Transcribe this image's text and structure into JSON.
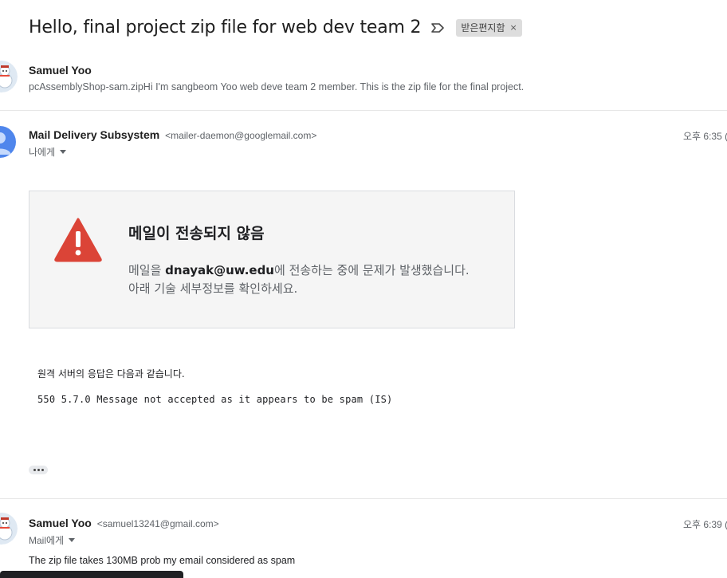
{
  "thread": {
    "subject": "Hello, final project zip file for web dev team 2",
    "label": "받은편지함",
    "label_remove": "×"
  },
  "messages": [
    {
      "sender_name": "Samuel Yoo",
      "snippet": "pcAssemblyShop-sam.zipHi I'm sangbeom Yoo web deve team 2 member. This is the zip file for the final project.",
      "avatar": "snowman-avatar"
    },
    {
      "sender_name": "Mail Delivery Subsystem",
      "sender_email": "<mailer-daemon@googlemail.com>",
      "to": "나에게",
      "time": "오후 6:35 (",
      "avatar": "person-avatar",
      "bounce": {
        "title": "메일이 전송되지 않음",
        "line1_prefix": "메일을 ",
        "line1_email": "dnayak@uw.edu",
        "line1_suffix": "에 전송하는 중에 문제가 발생했습니다.",
        "line2": "아래 기술 세부정보를 확인하세요."
      },
      "remote_intro": "원격 서버의 응답은 다음과 같습니다.",
      "remote_code": "550 5.7.0 Message not accepted as it appears to be spam (IS)"
    },
    {
      "sender_name": "Samuel Yoo",
      "sender_email": "<samuel13241@gmail.com>",
      "to": "Mail에게",
      "time": "오후 6:39 (",
      "body": "The zip file takes 130MB prob my email considered as spam",
      "avatar": "snowman-avatar"
    }
  ],
  "colors": {
    "warning_red": "#db4437",
    "avatar_blue": "#4f86ec",
    "card_bg": "#f5f5f5"
  }
}
